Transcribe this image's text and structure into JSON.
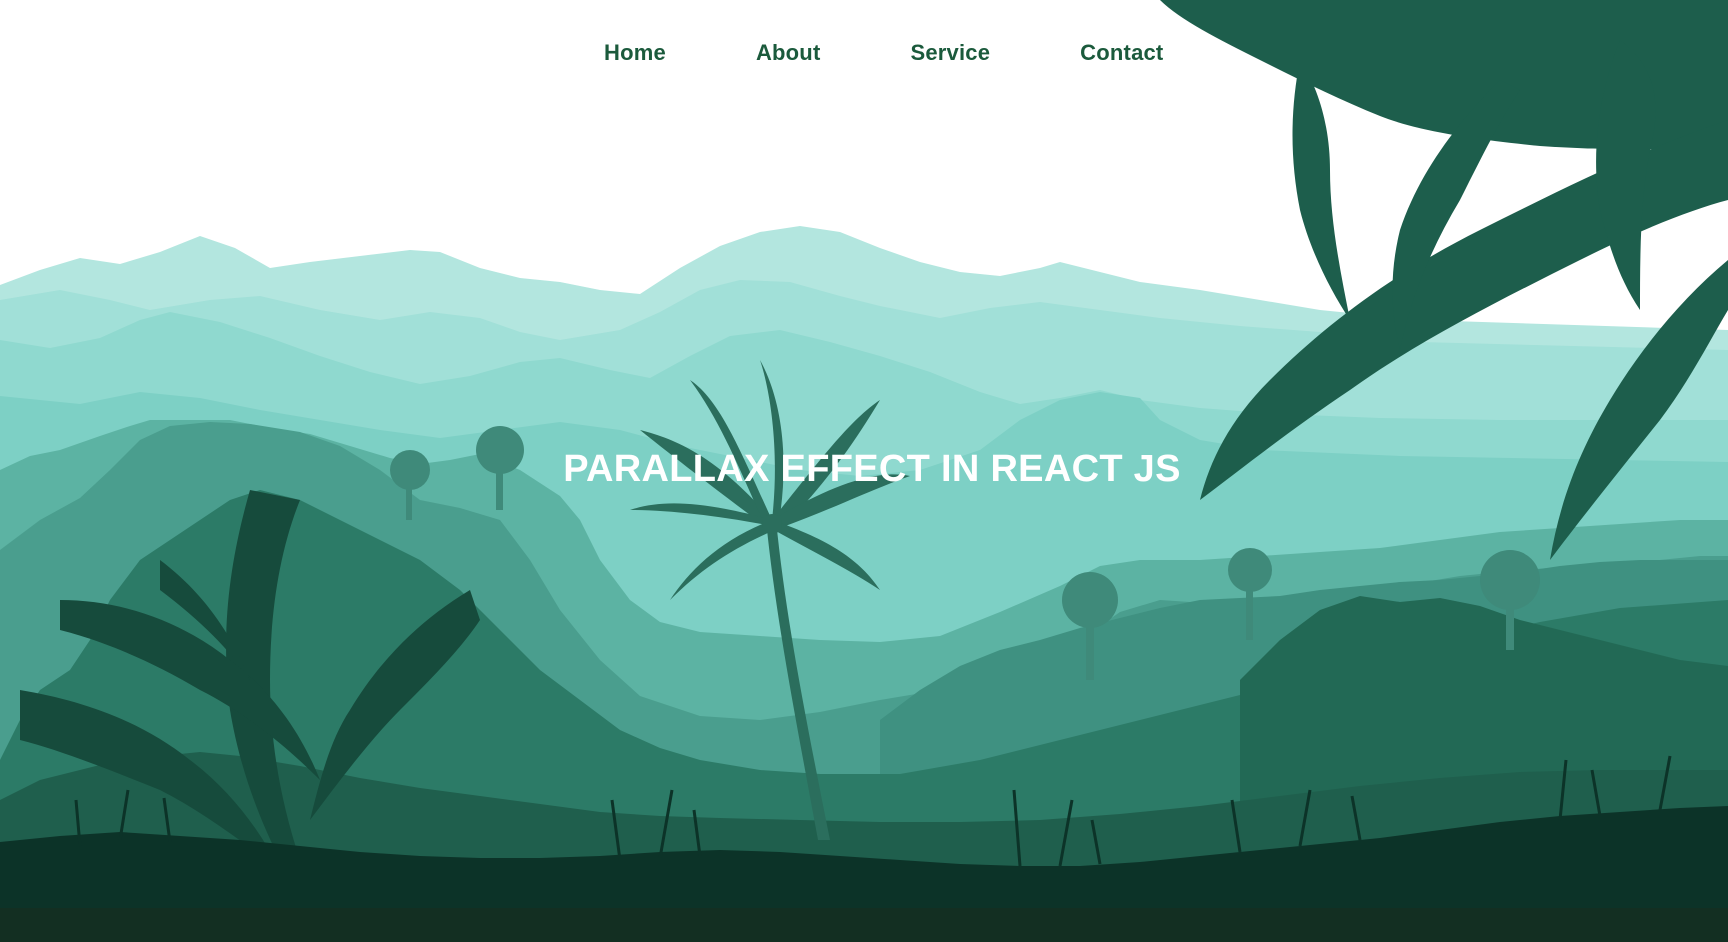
{
  "nav": {
    "items": [
      {
        "label": "Home"
      },
      {
        "label": "About"
      },
      {
        "label": "Service"
      },
      {
        "label": "Contact"
      }
    ]
  },
  "hero": {
    "title": "PARALLAX EFFECT IN REACT JS"
  },
  "colors": {
    "nav_text": "#1b5a3c",
    "title_text": "#ffffff",
    "sky": "#ffffff",
    "far_mountains": "#b3e6df",
    "mid_mountains": "#91dbd1",
    "jungle_mid": "#4fa696",
    "jungle_dark": "#2b7a66",
    "foliage": "#1d5e4c",
    "ground": "#0c3328",
    "bottom_strip": "#132f22"
  },
  "icons": [
    "palm-tree-icon",
    "fern-leaf-icon",
    "grass-icon",
    "tree-silhouette-icon"
  ]
}
